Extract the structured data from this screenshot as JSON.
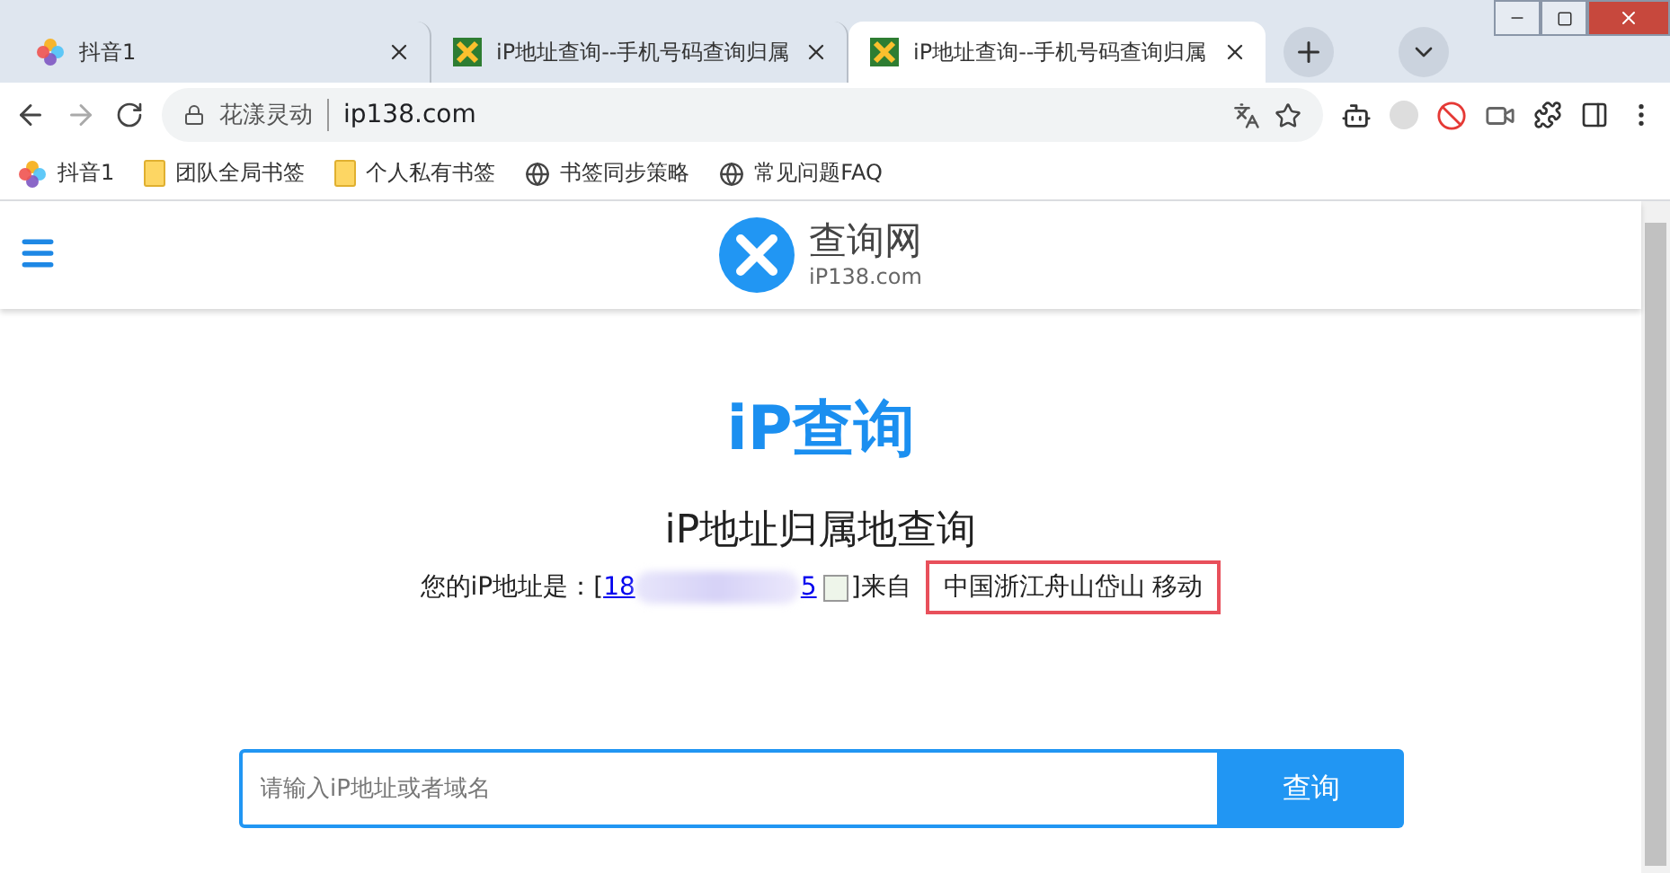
{
  "tabs": [
    {
      "title": "抖音1",
      "kind": "douyin",
      "selected": false
    },
    {
      "title": "iP地址查询--手机号码查询归属",
      "kind": "ip138",
      "selected": false
    },
    {
      "title": "iP地址查询--手机号码查询归属",
      "kind": "ip138",
      "selected": true
    }
  ],
  "address_bar": {
    "site_name": "花漾灵动",
    "url": "ip138.com"
  },
  "bookmarks": [
    {
      "label": "抖音1",
      "kind": "douyin"
    },
    {
      "label": "团队全局书签",
      "kind": "folder"
    },
    {
      "label": "个人私有书签",
      "kind": "folder"
    },
    {
      "label": "书签同步策略",
      "kind": "globe"
    },
    {
      "label": "常见问题FAQ",
      "kind": "globe"
    }
  ],
  "site_header": {
    "logo_title": "查询网",
    "logo_domain": "iP138.com"
  },
  "heading": "iP查询",
  "subheading": "iP地址归属地查询",
  "ip_line": {
    "prefix": "您的iP地址是：[",
    "ip_start": "18",
    "ip_end": "5",
    "suffix": "]来自",
    "location": "中国浙江舟山岱山 移动"
  },
  "search": {
    "placeholder": "请输入iP地址或者域名",
    "button": "查询"
  }
}
